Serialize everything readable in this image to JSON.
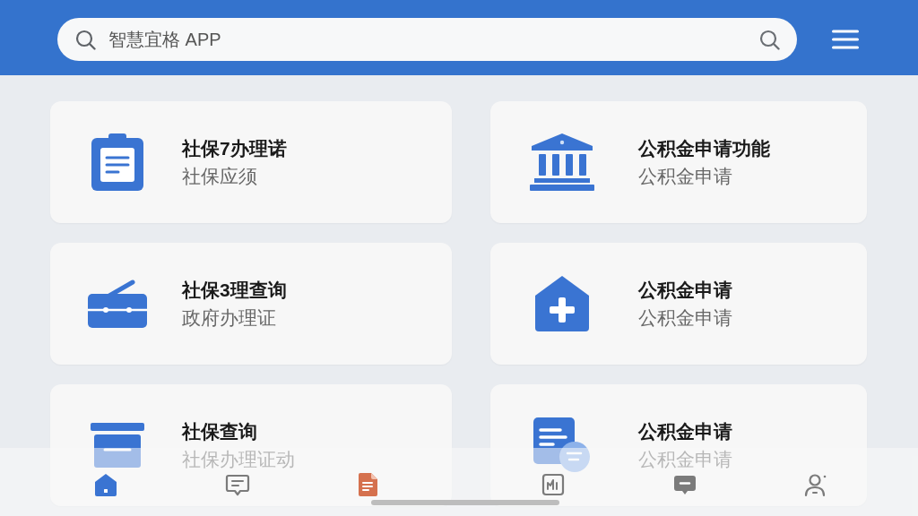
{
  "search": {
    "placeholder": "智慧宜格 APP"
  },
  "cards": [
    {
      "kind": "clipboard",
      "title": "社保7办理诺",
      "subtitle": "社保应须"
    },
    {
      "kind": "bank",
      "title": "公积金申请功能",
      "subtitle": "公积金申请"
    },
    {
      "kind": "briefcase",
      "title": "社保3理查询",
      "subtitle": "政府办理证"
    },
    {
      "kind": "house-plus",
      "title": "公积金申请",
      "subtitle": "公积金申请"
    },
    {
      "kind": "archive",
      "title": "社保查询",
      "subtitle": "社保办理证动"
    },
    {
      "kind": "document-chat",
      "title": "公积金申请",
      "subtitle": "公积金申请"
    }
  ],
  "tab_bar": {
    "tabs": [
      {
        "kind": "home",
        "selected": true
      },
      {
        "kind": "chat",
        "selected": false
      },
      {
        "kind": "document",
        "selected": false
      },
      {
        "kind": "chart",
        "selected": false
      },
      {
        "kind": "message",
        "selected": false
      },
      {
        "kind": "person",
        "selected": false
      }
    ]
  }
}
